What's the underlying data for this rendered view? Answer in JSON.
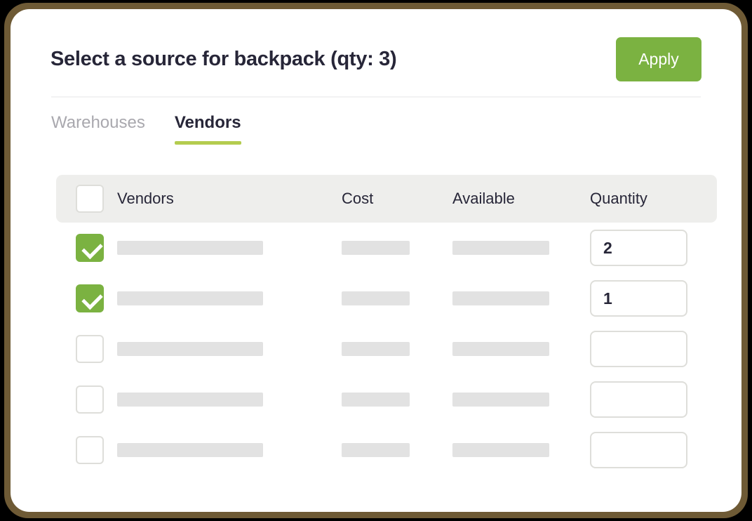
{
  "dialog": {
    "title": "Select a source for backpack (qty: 3)",
    "apply_label": "Apply"
  },
  "theme": {
    "accent_green": "#7bb241",
    "tab_underline_green": "#b4cc4f",
    "text_dark": "#272638",
    "text_muted": "#a9a8ae",
    "header_row_bg": "#eeeeec",
    "skeleton_gray": "#e2e2e2",
    "border_gray": "#dededa",
    "frame_brown": "#6e5a35",
    "page_bg": "#000000"
  },
  "tabs": [
    {
      "label": "Warehouses",
      "active": false
    },
    {
      "label": "Vendors",
      "active": true
    }
  ],
  "table": {
    "select_all_checked": false,
    "columns": [
      {
        "key": "vendors",
        "label": "Vendors"
      },
      {
        "key": "cost",
        "label": "Cost"
      },
      {
        "key": "available",
        "label": "Available"
      },
      {
        "key": "quantity",
        "label": "Quantity"
      }
    ],
    "rows": [
      {
        "checked": true,
        "vendor": "",
        "cost": "",
        "available": "",
        "quantity": "2"
      },
      {
        "checked": true,
        "vendor": "",
        "cost": "",
        "available": "",
        "quantity": "1"
      },
      {
        "checked": false,
        "vendor": "",
        "cost": "",
        "available": "",
        "quantity": ""
      },
      {
        "checked": false,
        "vendor": "",
        "cost": "",
        "available": "",
        "quantity": ""
      },
      {
        "checked": false,
        "vendor": "",
        "cost": "",
        "available": "",
        "quantity": ""
      }
    ]
  }
}
